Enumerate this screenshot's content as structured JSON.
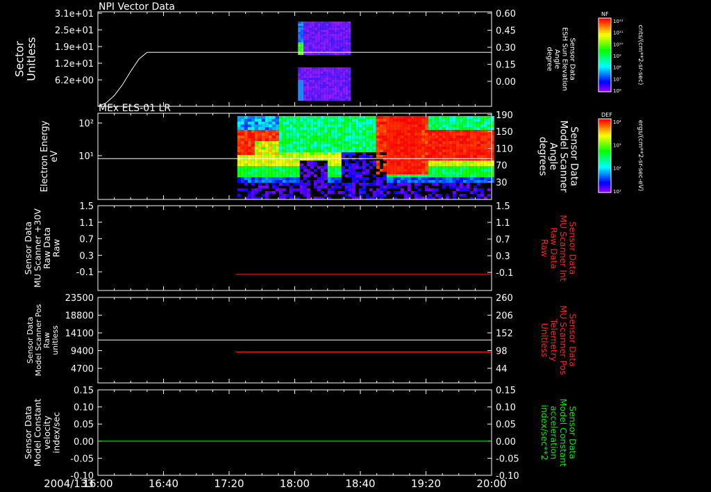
{
  "time_axis": {
    "date": "2004/133",
    "ticks": [
      "16:00",
      "16:40",
      "17:20",
      "18:00",
      "18:40",
      "19:20",
      "20:00"
    ],
    "range_minutes": [
      0,
      240
    ]
  },
  "colors": {
    "white": "#ffffff",
    "red": "#ff2020",
    "green": "#00ee00",
    "panel_border": "#ffffff",
    "background": "#000000"
  },
  "chart_data": [
    {
      "type": "heatmap",
      "title": "NPI Vector Data",
      "ylabel": [
        "Sector",
        "Unitless"
      ],
      "yticks": [
        "3.1e+01",
        "2.5e+01",
        "1.9e+01",
        "1.2e+01",
        "6.2e+00"
      ],
      "right_ylabel": [
        "Sensor Data",
        "ESH Sun Elevation",
        "Angle",
        "degree"
      ],
      "right_yticks": [
        "0.60",
        "0.45",
        "0.30",
        "0.15",
        "0.00"
      ],
      "right_ylim": [
        -0.1,
        0.6
      ],
      "colorbar": {
        "label": "NF",
        "units": "cnts/(cm**2-sr-sec)",
        "ticks": [
          "10¹²",
          "10¹¹",
          "10¹⁰",
          "10⁹",
          "10⁸",
          "10⁷",
          "10⁶"
        ]
      },
      "heatmap_time_range_minutes": [
        122,
        153
      ],
      "line": {
        "color": "white",
        "x_minutes": [
          0,
          5,
          10,
          15,
          20,
          25,
          30,
          240
        ],
        "y": [
          -0.1,
          -0.075,
          -0.02,
          0.06,
          0.16,
          0.25,
          0.3,
          0.3
        ]
      }
    },
    {
      "type": "heatmap",
      "title": "MEx ELS-01 LR",
      "ylabel": [
        "Electron Energy",
        "eV"
      ],
      "yticks": [
        "10²",
        "10¹"
      ],
      "right_ylabel": [
        "Sensor Data",
        "Model Scanner",
        "Angle",
        "degrees"
      ],
      "right_yticks": [
        "190",
        "150",
        "110",
        "70",
        "30"
      ],
      "right_ylim": [
        0,
        190
      ],
      "colorbar": {
        "label": "DEF",
        "units": "ergs/(cm**2-sr-sec-eV)",
        "ticks": [
          "10⁴",
          "10³",
          "10²",
          "10¹"
        ]
      },
      "heatmap_time_range_minutes": [
        85,
        240
      ],
      "line": {
        "color": "white",
        "x_minutes": [
          0,
          240
        ],
        "y": [
          90,
          90
        ]
      }
    },
    {
      "type": "line",
      "ylabel": [
        "Sensor Data",
        "MU Scanner +30V",
        "Raw Data",
        "Raw"
      ],
      "yticks": [
        "1.5",
        "1.1",
        "0.7",
        "0.3",
        "-0.1"
      ],
      "ylim": [
        -0.35,
        1.5
      ],
      "right_ylabel": [
        "Sensor Data",
        "MU Scanner Int",
        "Raw Data",
        "Raw"
      ],
      "right_yticks": [
        "1.5",
        "1.1",
        "0.7",
        "0.3",
        "-0.1"
      ],
      "right_ylim": [
        -0.35,
        1.5
      ],
      "series": [
        {
          "color": "red",
          "axis": "right",
          "x_minutes": [
            84,
            240
          ],
          "y": [
            0.0,
            0.0
          ]
        }
      ]
    },
    {
      "type": "line",
      "ylabel": [
        "Sensor Data",
        "Model Scanner Pos",
        "Raw",
        "unitless"
      ],
      "yticks": [
        "23500",
        "18800",
        "14100",
        "9400",
        "4700"
      ],
      "ylim": [
        0,
        23500
      ],
      "right_ylabel": [
        "Sensor Data",
        "MU Scanner Pos",
        "Telemetry",
        "Unitless"
      ],
      "right_yticks": [
        "260",
        "206",
        "152",
        "98",
        "44"
      ],
      "right_ylim": [
        0,
        260
      ],
      "series": [
        {
          "color": "white",
          "axis": "left",
          "x_minutes": [
            0,
            240
          ],
          "y": [
            11800,
            11800
          ]
        },
        {
          "color": "red",
          "axis": "right",
          "x_minutes": [
            84,
            240
          ],
          "y": [
            94,
            94
          ]
        }
      ]
    },
    {
      "type": "line",
      "ylabel": [
        "Sensor Data",
        "Model Constant",
        "velocity",
        "index/sec"
      ],
      "yticks": [
        "0.15",
        "0.10",
        "0.05",
        "0.00",
        "-0.05",
        "-0.10"
      ],
      "ylim": [
        -0.1,
        0.15
      ],
      "right_ylabel": [
        "Sensor Data",
        "Model Constant",
        "acceleration",
        "index/sec**2"
      ],
      "right_yticks": [
        "0.15",
        "0.10",
        "0.05",
        "0.00",
        "-0.05",
        "-0.10"
      ],
      "right_ylim": [
        -0.1,
        0.15
      ],
      "series": [
        {
          "color": "green",
          "axis": "left",
          "x_minutes": [
            0,
            240
          ],
          "y": [
            0.0,
            0.0
          ]
        }
      ]
    }
  ]
}
